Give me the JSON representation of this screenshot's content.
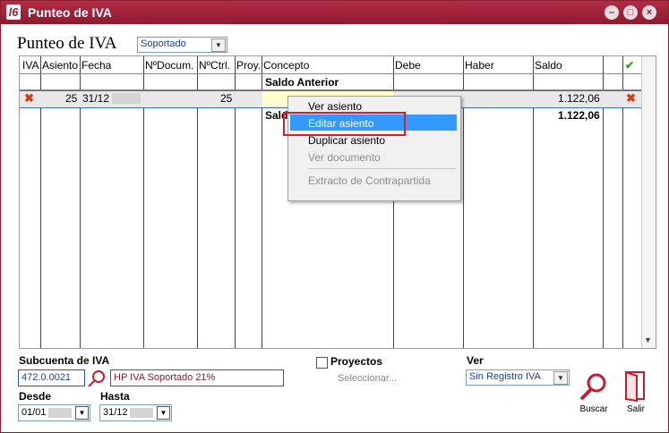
{
  "window": {
    "title": "Punteo de IVA"
  },
  "form": {
    "title": "Punteo de IVA",
    "type_select": "Soportado"
  },
  "grid": {
    "headers": {
      "iva": "IVA",
      "asiento": "Asiento",
      "fecha": "Fecha",
      "ndocum": "NºDocum.",
      "nctrl": "NºCtrl.",
      "proy": "Proy.",
      "concepto": "Concepto",
      "debe": "Debe",
      "haber": "Haber",
      "saldo": "Saldo"
    },
    "header_check": "✔",
    "saldo_anterior": "Saldo Anterior",
    "row1": {
      "asiento": "25",
      "fecha": "31/12",
      "nctrl": "25",
      "saldo": "1.122,06"
    },
    "row2": {
      "concepto": "Sald",
      "saldo": "1.122,06"
    }
  },
  "context_menu": {
    "items": [
      "Ver asiento",
      "Editar asiento",
      "Duplicar asiento",
      "Ver documento",
      "Extracto de Contrapartida"
    ],
    "highlighted": "Editar asiento"
  },
  "bottom": {
    "subcuenta_label": "Subcuenta de IVA",
    "subcuenta_value": "472.0.0021",
    "subcuenta_desc": "HP IVA Soportado 21%",
    "proyectos_label": "Proyectos",
    "seleccionar": "Seleccionar...",
    "ver_label": "Ver",
    "ver_value": "Sin Registro IVA",
    "desde_label": "Desde",
    "desde_value": "01/01",
    "hasta_label": "Hasta",
    "hasta_value": "31/12",
    "buscar": "Buscar",
    "salir": "Salir"
  },
  "colors": {
    "titlebar": "#9e2238",
    "accent": "#3399ff",
    "red_x": "#d63a10",
    "check": "#2e9e2e"
  }
}
